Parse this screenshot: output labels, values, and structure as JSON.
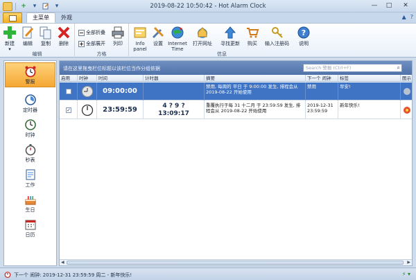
{
  "window": {
    "title": "2019-08-22 10:50:42 - Hot Alarm Clock",
    "controls": {
      "minimize": "—",
      "maximize": "□",
      "close": "✕"
    }
  },
  "qat": {
    "add": "+",
    "dropdown": "▾"
  },
  "tabs": [
    {
      "label": "主菜单",
      "active": true
    },
    {
      "label": "外观",
      "active": false
    }
  ],
  "tab_controls": {
    "collapse": "▲",
    "help": "?"
  },
  "ribbon": {
    "groups": [
      {
        "label": "编辑",
        "buttons": [
          "新建",
          "编辑",
          "复制",
          "删除"
        ]
      },
      {
        "label": "方格",
        "small_buttons": [
          "全部折叠",
          "全部展开"
        ],
        "buttons": [
          "列印"
        ]
      },
      {
        "label": "信息",
        "buttons": [
          "Info panel",
          "设置",
          "Internet Time",
          "打开网址",
          "寻找更新",
          "购买",
          "输入注册码",
          "说明"
        ]
      }
    ],
    "new_dropdown": "▾"
  },
  "sidebar": {
    "items": [
      {
        "label": "警报",
        "icon": "alarm-clock-icon",
        "active": true
      },
      {
        "label": "定时器",
        "icon": "timer-icon",
        "active": false
      },
      {
        "label": "时钟",
        "icon": "clock-icon",
        "active": false
      },
      {
        "label": "秒表",
        "icon": "stopwatch-icon",
        "active": false
      },
      {
        "label": "工作",
        "icon": "task-icon",
        "active": false
      },
      {
        "label": "生日",
        "icon": "cake-icon",
        "active": false
      },
      {
        "label": "日历",
        "icon": "calendar-icon",
        "active": false
      }
    ]
  },
  "grid": {
    "group_hint": "请在这里拖曳栏位标题以该栏位当作分组依据",
    "search_placeholder": "Search 警报 (Ctrl+F)",
    "columns": [
      "启用",
      "时钟",
      "时间",
      "计时器",
      "摘要",
      "下一个 闹钟",
      "标签",
      "图示"
    ],
    "rows": [
      {
        "enabled": false,
        "time": "09:00:00",
        "timer": "",
        "summary": "禁用, 每周的 平日 于 9:00:00 发生, 排程会从 2019-08-22 开始使用",
        "next": "禁用",
        "label": "早安!",
        "selected": true
      },
      {
        "enabled": true,
        "time": "23:59:59",
        "timer": "4 ? 9 ?\n13:09:17",
        "summary": "重覆执行于每 31 十二月 于 23:59:59 发生, 排程会从 2019-08-22 开始使用",
        "next": "2019-12-31 23:59:59",
        "label": "新年快乐!",
        "selected": false
      }
    ]
  },
  "statusbar": {
    "text": "下一个 闹钟: 2019-12-31 23:59:59 周二 - 新年快乐!",
    "right": "⚡ ▾"
  },
  "colors": {
    "selected_row": "#3f73c4",
    "active_sidebar": "#f5a733",
    "ribbon_bg": "#e8f0fa",
    "group_bar": "#4f72aa"
  }
}
